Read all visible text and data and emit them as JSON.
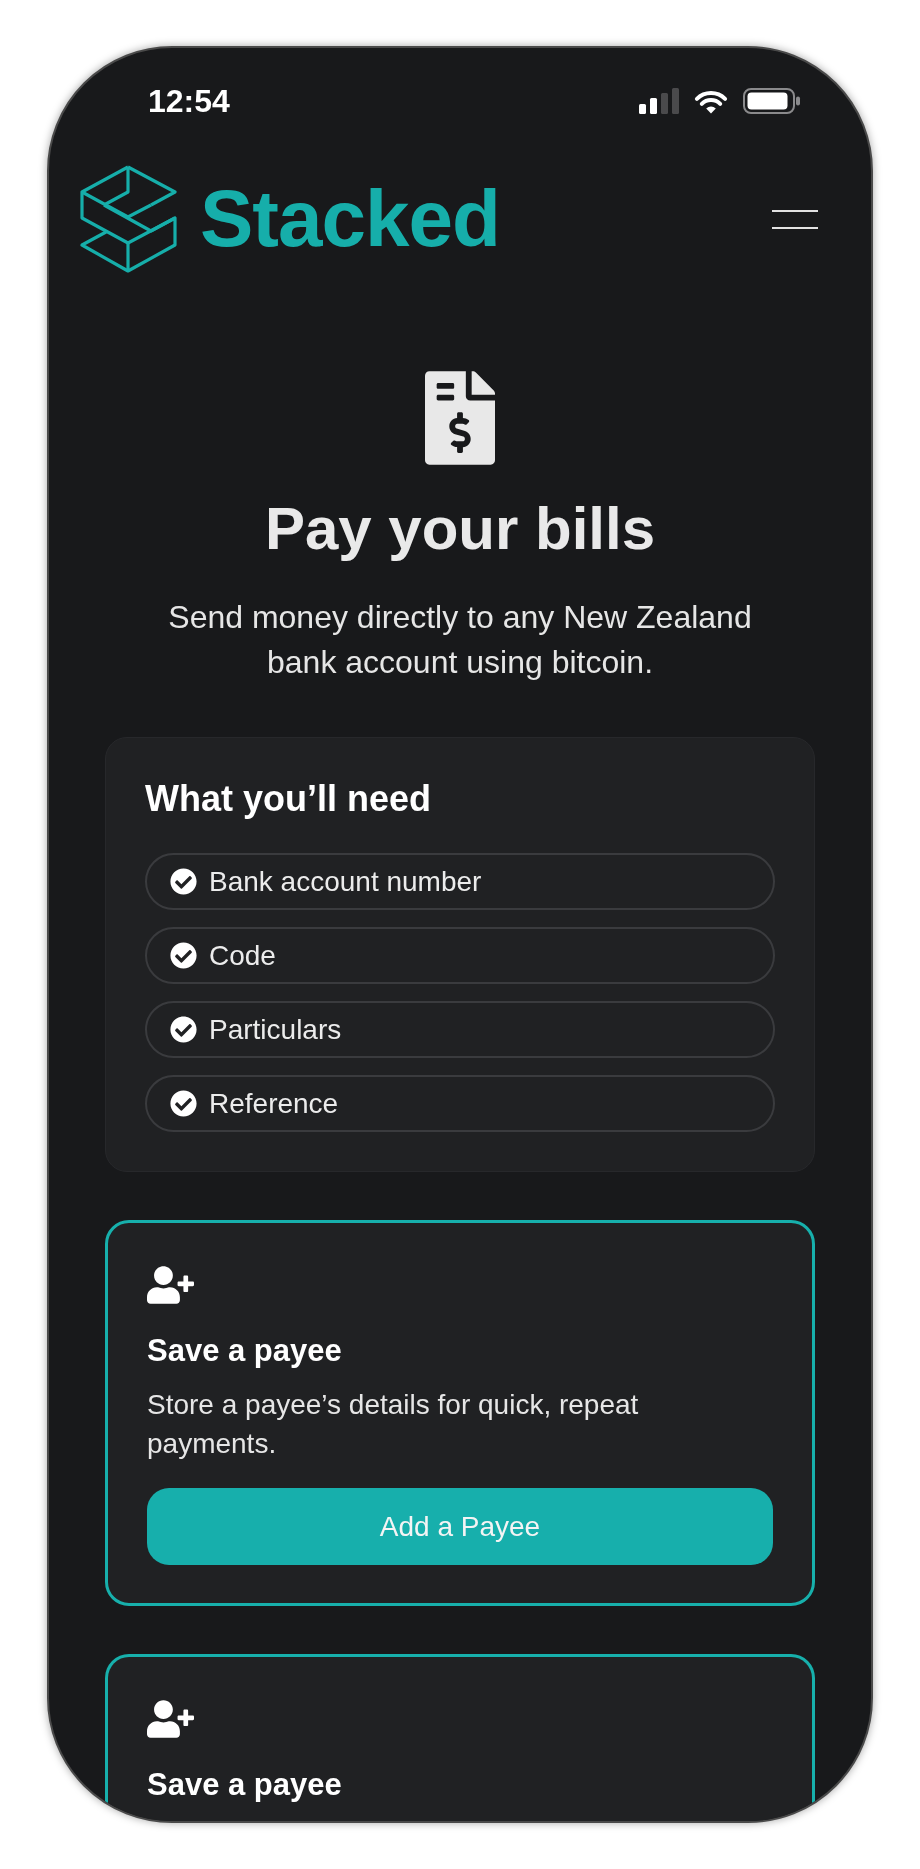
{
  "status_bar": {
    "time": "12:54"
  },
  "header": {
    "brand": "Stacked"
  },
  "hero": {
    "title": "Pay your bills",
    "subtitle": "Send money directly to any New Zealand bank account using bitcoin."
  },
  "requirements": {
    "title": "What you’ll need",
    "items": [
      {
        "label": "Bank account number",
        "checked": true
      },
      {
        "label": "Code",
        "checked": true
      },
      {
        "label": "Particulars",
        "checked": true
      },
      {
        "label": "Reference",
        "checked": true
      }
    ]
  },
  "payee_cards": [
    {
      "title": "Save a payee",
      "description": "Store a payee’s details for quick, repeat payments.",
      "button": "Add a Payee"
    },
    {
      "title": "Save a payee"
    }
  ]
}
